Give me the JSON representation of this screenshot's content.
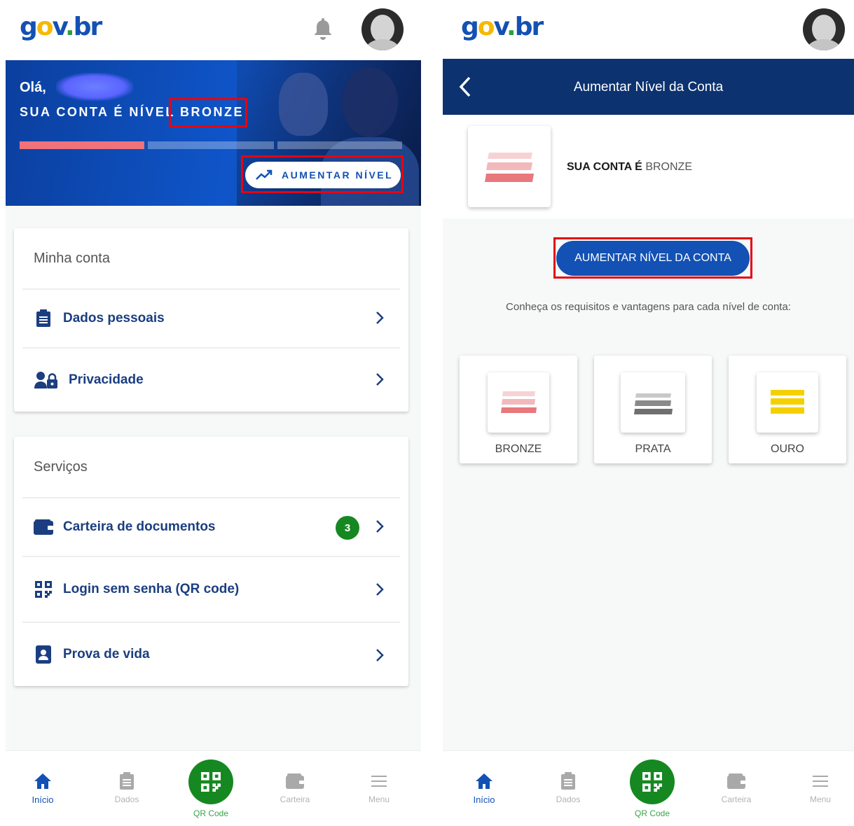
{
  "left": {
    "greeting": "Olá,",
    "level_prefix": "SUA CONTA É NÍVEL",
    "level_value": "BRONZE",
    "raise_level_button": "AUMENTAR NÍVEL",
    "progress_fraction": 0.32,
    "sections": {
      "account": {
        "title": "Minha conta",
        "items": [
          {
            "label": "Dados pessoais",
            "icon": "clipboard-icon"
          },
          {
            "label": "Privacidade",
            "icon": "user-lock-icon"
          }
        ]
      },
      "services": {
        "title": "Serviços",
        "items": [
          {
            "label": "Carteira de documentos",
            "icon": "wallet-icon",
            "badge": "3"
          },
          {
            "label": "Login sem senha (QR code)",
            "icon": "qr-code-icon"
          },
          {
            "label": "Prova de vida",
            "icon": "id-badge-icon"
          }
        ]
      }
    }
  },
  "right": {
    "header_title": "Aumentar Nível da Conta",
    "account_label": "SUA CONTA É",
    "account_level": "BRONZE",
    "raise_button": "AUMENTAR NÍVEL DA CONTA",
    "info": "Conheça os requisitos e vantagens para cada nível de conta:",
    "tiers": [
      {
        "label": "BRONZE",
        "color": "#e8787c"
      },
      {
        "label": "PRATA",
        "color": "#6f6f6f"
      },
      {
        "label": "OURO",
        "color": "#f5d000"
      }
    ]
  },
  "bottom_nav": {
    "items": [
      "Início",
      "Dados",
      "QR Code",
      "Carteira",
      "Menu"
    ]
  },
  "colors": {
    "primary_blue": "#1351b4",
    "dark_blue": "#0c326f",
    "green": "#168821",
    "highlight_red": "#e30613"
  }
}
